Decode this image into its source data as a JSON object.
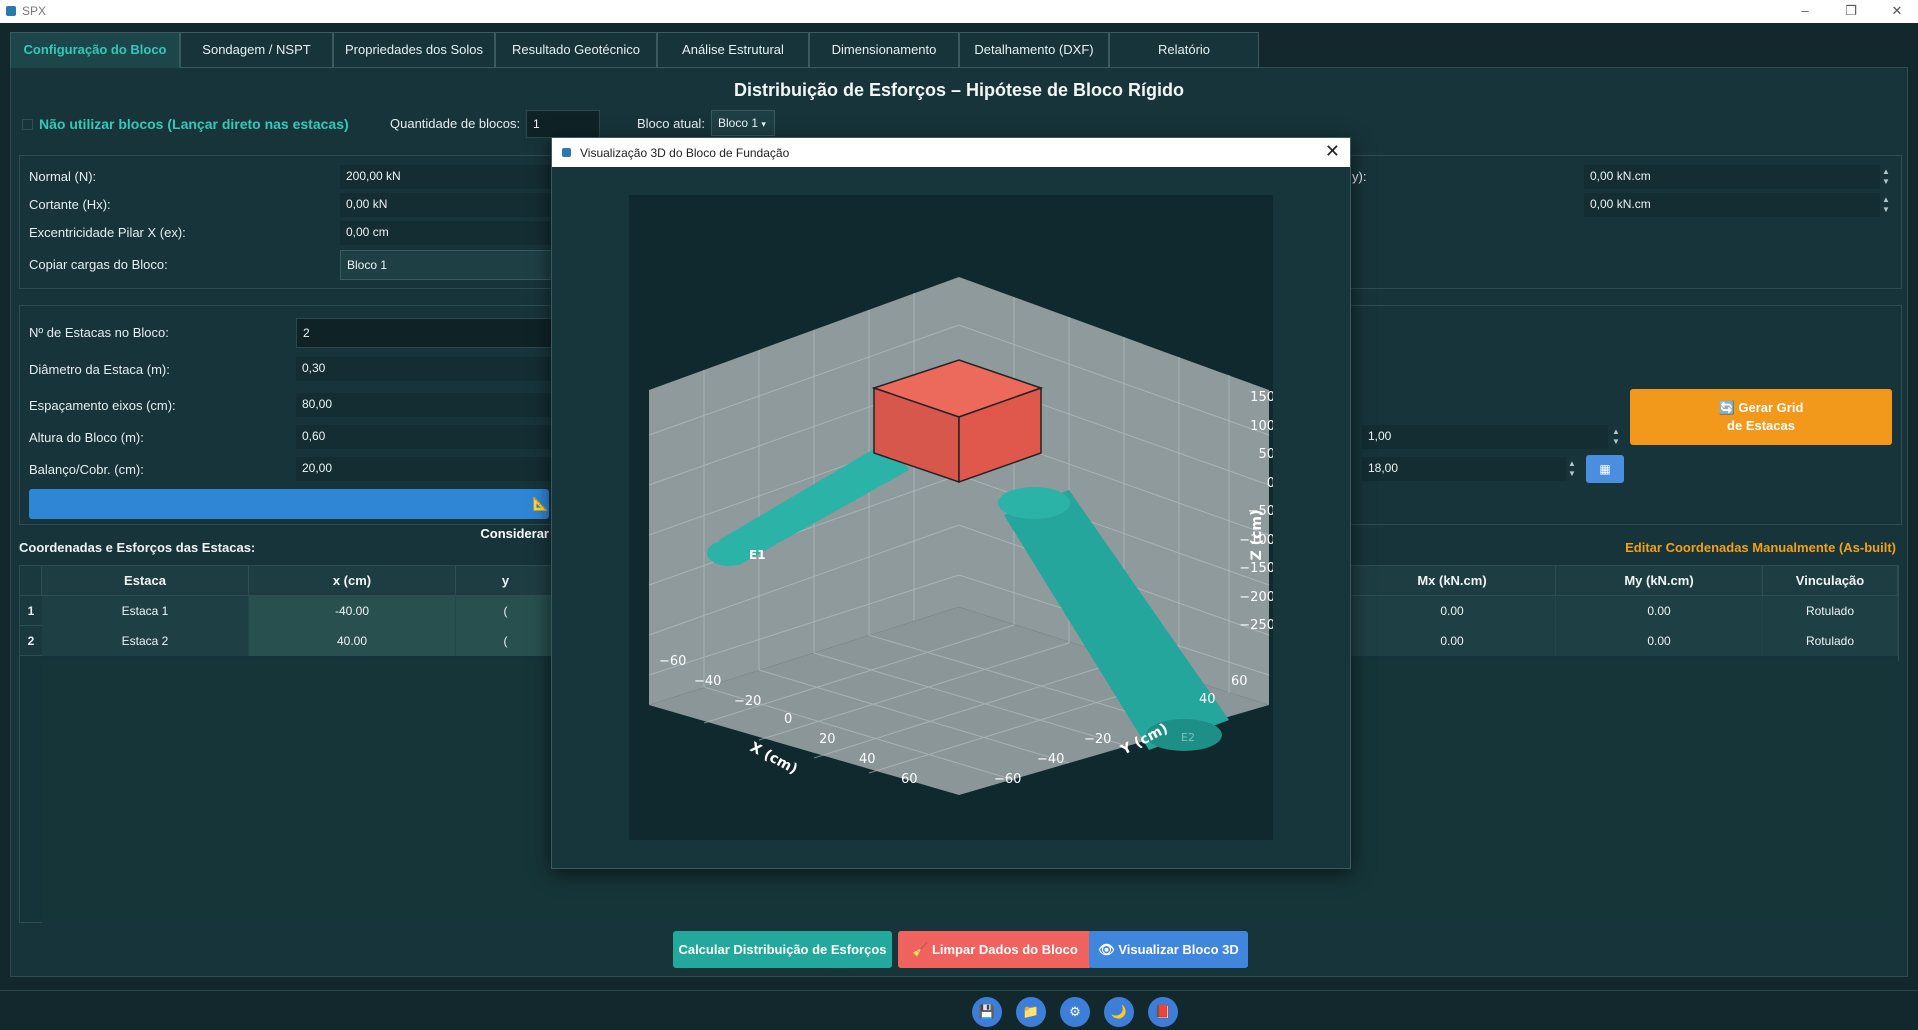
{
  "window": {
    "title": "SPX",
    "minimize": "–",
    "maximize": "❐",
    "close": "✕"
  },
  "tabs": [
    {
      "label": "Configuração do Bloco",
      "active": true
    },
    {
      "label": "Sondagem / NSPT"
    },
    {
      "label": "Propriedades dos Solos"
    },
    {
      "label": "Resultado Geotécnico"
    },
    {
      "label": "Análise Estrutural"
    },
    {
      "label": "Dimensionamento"
    },
    {
      "label": "Detalhamento (DXF)"
    },
    {
      "label": "Relatório"
    }
  ],
  "main": {
    "heading": "Distribuição de Esforços – Hipótese de Bloco Rígido",
    "no_blocks_checkbox": "Não utilizar blocos (Lançar direto nas estacas)",
    "qty_label": "Quantidade de blocos:",
    "qty_value": "1",
    "current_block_label": "Bloco atual:",
    "current_block_value": "Bloco 1"
  },
  "loads": {
    "normal_label": "Normal (N):",
    "normal_value": "200,00 kN",
    "shear_label": "Cortante (Hx):",
    "shear_value": "0,00 kN",
    "ecc_label": "Excentricidade Pilar X (ex):",
    "ecc_value": "0,00 cm",
    "copy_label": "Copiar cargas do Bloco:",
    "copy_value": "Bloco 1",
    "right_partial_label": "y):",
    "moment1_value": "0,00 kN.cm",
    "moment2_value": "0,00 kN.cm"
  },
  "piles": {
    "count_label": "Nº de Estacas no Bloco:",
    "count_value": "2",
    "diam_label": "Diâmetro da Estaca (m):",
    "diam_value": "0,30",
    "spacing_label": "Espaçamento eixos (cm):",
    "spacing_value": "80,00",
    "height_label": "Altura do Bloco (m):",
    "height_value": "0,60",
    "overhang_label": "Balanço/Cobr. (cm):",
    "overhang_value": "20,00",
    "consider_button": "📐 Considerar",
    "right_value1": "1,00",
    "right_value2": "18,00",
    "grid_button_line1": "🔄 Gerar Grid",
    "grid_button_line2": "de Estacas",
    "small_button": "▦"
  },
  "table": {
    "title": "Coordenadas e Esforços das Estacas:",
    "edit_link": "Editar Coordenadas Manualmente (As-built)",
    "headers": [
      "Estaca",
      "x (cm)",
      "y",
      "Mx (kN.cm)",
      "My (kN.cm)",
      "Vinculação"
    ],
    "rows": [
      {
        "idx": "1",
        "estaca": "Estaca 1",
        "x": "-40.00",
        "y": "(",
        "mx": "0.00",
        "my": "0.00",
        "vinc": "Rotulado"
      },
      {
        "idx": "2",
        "estaca": "Estaca 2",
        "x": "40.00",
        "y": "(",
        "mx": "0.00",
        "my": "0.00",
        "vinc": "Rotulado"
      }
    ]
  },
  "actions": {
    "calc": "Calcular Distribuição de Esforços",
    "clear": "🧹 Limpar Dados do Bloco",
    "view3d": "👁 Visualizar Bloco 3D"
  },
  "statusbar": {
    "icons": [
      "💾",
      "📁",
      "⚙",
      "🌙",
      "📕"
    ]
  },
  "modal": {
    "title": "Visualização 3D do Bloco de Fundação",
    "close": "✕",
    "chart_data": {
      "type": "3d-scene",
      "xlabel": "X (cm)",
      "ylabel": "Y (cm)",
      "zlabel": "Z (cm)",
      "x_ticks": [
        "−60",
        "−40",
        "−20",
        "0",
        "20",
        "40",
        "60"
      ],
      "y_ticks": [
        "−60",
        "−40",
        "−20",
        "40",
        "60"
      ],
      "z_ticks": [
        "150",
        "100",
        "50",
        "0",
        "−50",
        "−100",
        "−150",
        "−200",
        "−250"
      ],
      "pile_labels": [
        "E1",
        "E2"
      ],
      "colors": {
        "block": "#e0584c",
        "pile": "#2bb3a8",
        "pane": "#8e9a9b"
      }
    }
  }
}
